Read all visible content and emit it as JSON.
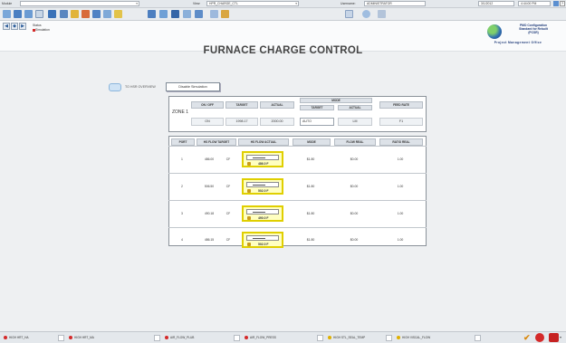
{
  "topbar": {
    "module_label": "Module",
    "view_label": "View:",
    "view_value": "HPR_CHARGE_CTL",
    "username_label": "Username:",
    "username_value": "ADMINISTRATOR",
    "date": "3/1/2012",
    "time": "4:44:00 PM"
  },
  "subheader": {
    "path_title": "Status",
    "path_mode": "Simulation"
  },
  "page_title": "FURNACE CHARGE CONTROL",
  "logo": {
    "line1": "PMO Configuration",
    "line2": "Standard for Rebuilt",
    "line3": "(PCSR)",
    "tagline": "Project Management Office"
  },
  "overview": {
    "label": "TO HSR OVERVIEW",
    "disable_button": "Disable Simulation"
  },
  "zone": {
    "label": "ZONE 1",
    "headers": {
      "on_off": "ON / OFF",
      "target": "TARGET",
      "actual": "ACTUAL",
      "mode": "MODE",
      "mode_target": "TARGET",
      "mode_actual": "ACTUAL",
      "feed_rate": "FEED RATE"
    },
    "values": {
      "on_off": "ON",
      "target": "1998.17",
      "actual": "2000.00",
      "mode_target": "AUTO",
      "mode_actual": "LM",
      "feed_rate": "F1"
    }
  },
  "ports": {
    "headers": [
      "PORT",
      "HS FLOW TARGET",
      "HS FLOW ACTUAL",
      "MODE",
      "FLOW REAL",
      "RATIO REAL"
    ],
    "rows": [
      {
        "port": "1",
        "target": "486.00",
        "unit": "CF",
        "actual": "486.0 F",
        "mode": "$1.80",
        "flow": "$0.00",
        "ratio": "1.00"
      },
      {
        "port": "2",
        "target": "506.50",
        "unit": "CF",
        "actual": "502.0 F",
        "mode": "$1.80",
        "flow": "$0.00",
        "ratio": "1.00"
      },
      {
        "port": "3",
        "target": "490.18",
        "unit": "CF",
        "actual": "490.0 F",
        "mode": "$1.80",
        "flow": "$0.00",
        "ratio": "1.00"
      },
      {
        "port": "4",
        "target": "486.15",
        "unit": "CF",
        "actual": "502.0 F",
        "mode": "$1.80",
        "flow": "$0.00",
        "ratio": "1.00"
      }
    ]
  },
  "statusbar": {
    "items": [
      {
        "label": "HIGH HRT_HA",
        "color": "#d42a2a"
      },
      {
        "label": "HIGH HRT_MA",
        "color": "#d42a2a"
      },
      {
        "label": "AIR_FLOW_PLUB",
        "color": "#d42a2a"
      },
      {
        "label": "AIR_FLOW_PRESS",
        "color": "#d42a2a"
      },
      {
        "label": "HIGH STL_SEAL_TEMP",
        "color": "#e0b000"
      },
      {
        "label": "HIGH VISCAL_FLOW",
        "color": "#e0b000"
      }
    ]
  },
  "colors": {
    "accent": "#2b5c9a",
    "highlight": "#e0cf00",
    "alarm": "#d42a2a"
  }
}
